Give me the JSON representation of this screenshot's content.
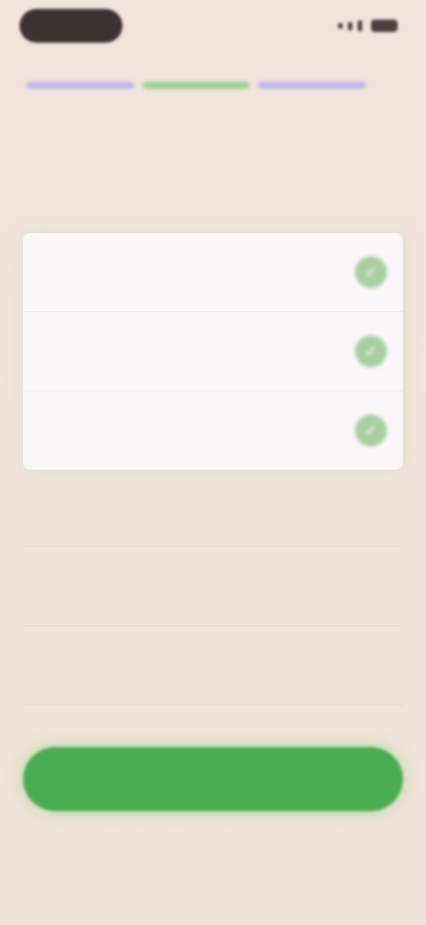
{
  "status_bar": {
    "time": "",
    "icons": [
      "signal-icon",
      "wifi-icon",
      "battery-icon"
    ]
  },
  "progress": {
    "steps": [
      "done",
      "active",
      "todo"
    ],
    "current_step": 2,
    "total_steps": 3
  },
  "header": {
    "title": "",
    "subtitle": ""
  },
  "selected_options": [
    {
      "label": "",
      "selected": true
    },
    {
      "label": "",
      "selected": true
    },
    {
      "label": "",
      "selected": true
    }
  ],
  "other_options": [
    {
      "label": "",
      "selected": false
    },
    {
      "label": "",
      "selected": false
    },
    {
      "label": "",
      "selected": false
    }
  ],
  "actions": {
    "continue_label": "",
    "skip_label": ""
  },
  "colors": {
    "background": "#efe2d8",
    "accent_green": "#49ad4f",
    "check_green": "#a9cfa0",
    "progress_purple": "#bdb6e4",
    "progress_green": "#9bd18c"
  }
}
